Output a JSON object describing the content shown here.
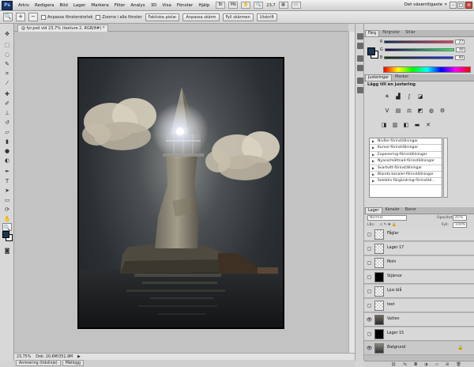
{
  "menubar": {
    "logo": "Ps",
    "items": [
      "Arkiv",
      "Redigera",
      "Bild",
      "Lager",
      "Markera",
      "Filter",
      "Analys",
      "3D",
      "Visa",
      "Fönster",
      "Hjälp"
    ],
    "zoom": "23,7",
    "workspace": "Det väsentligaste"
  },
  "options": {
    "check1": "Anpassa fönsterstorlek",
    "check2": "Zooma i alla fönster",
    "buttons": [
      "Faktiska pixlar",
      "Anpassa skärm",
      "Fyll skärmen",
      "Utskrift"
    ]
  },
  "document": {
    "tab": "@ fyr.psd vid 23,7% (texture 2, RGB/8#) *",
    "zoom": "23,75%",
    "doc_size": "Dok: 20,6M/351,9M",
    "bottom_tabs": [
      "Animering (tidslinje)",
      "Mätlogg"
    ]
  },
  "colors": {
    "foreground": "#1c3651",
    "background": "#ffffff"
  },
  "color_panel": {
    "tabs": [
      "Färg",
      "Färgrutor",
      "Stilar"
    ],
    "r": "27",
    "g": "49",
    "b": "90",
    "r_label": "R",
    "g_label": "G",
    "b_label": "B"
  },
  "adjustments": {
    "tabs": [
      "Justeringar",
      "Masker"
    ],
    "title": "Lägg till en justering",
    "presets": [
      "Nivåer-förinställningar",
      "Kurvor-förinställningar",
      "Exponering-förinställningar",
      "Nyans/mättnad-förinställningar",
      "Svartvitt-förinställningar",
      "Blanda kanaler-förinställningar",
      "Selektiv färgändring-förinställ..."
    ]
  },
  "layers": {
    "tabs": [
      "Lager",
      "Kanaler",
      "Banor"
    ],
    "blend_mode": "Normal",
    "opacity_label": "Opacitet:",
    "opacity": "45%",
    "lock_label": "Lås:",
    "fill_label": "Fyll:",
    "fill": "100%",
    "rows": [
      {
        "name": "Fåglar",
        "visible": false,
        "thumb": "transparent"
      },
      {
        "name": "Lager 17",
        "visible": false,
        "thumb": "transparent"
      },
      {
        "name": "Moln",
        "visible": false,
        "thumb": "transparent"
      },
      {
        "name": "Stjärnor",
        "visible": false,
        "thumb": "dark"
      },
      {
        "name": "Ljus blå",
        "visible": false,
        "thumb": "transparent"
      },
      {
        "name": "text",
        "visible": false,
        "thumb": "transparent"
      },
      {
        "name": "Vatten",
        "visible": true,
        "thumb": "photo"
      },
      {
        "name": "Lager 15",
        "visible": false,
        "thumb": "dark"
      },
      {
        "name": "Bakgrund",
        "visible": true,
        "thumb": "photo"
      }
    ]
  }
}
